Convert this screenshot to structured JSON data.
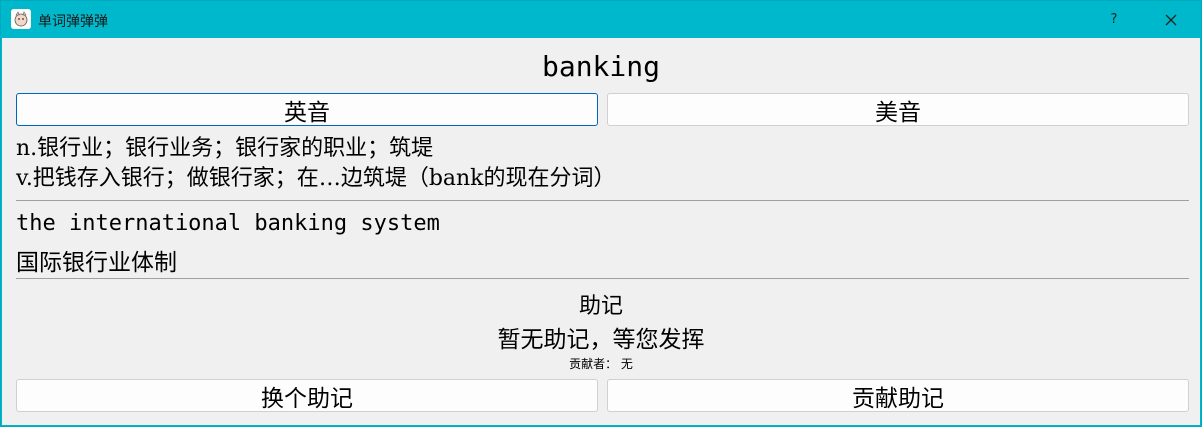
{
  "window": {
    "title": "单词弹弹弹",
    "help_label": "?",
    "close_label": "✕",
    "icon": "cartoon-app-icon"
  },
  "word": "banking",
  "pronunciation": {
    "uk_label": "英音",
    "us_label": "美音"
  },
  "definitions": [
    "n.银行业；银行业务；银行家的职业；筑堤",
    "v.把钱存入银行；做银行家；在…边筑堤（bank的现在分词）"
  ],
  "example": {
    "en": "the international banking system",
    "zh": "国际银行业体制"
  },
  "mnemonic": {
    "title": "助记",
    "text": "暂无助记，等您发挥",
    "contributor": "贡献者： 无",
    "next_label": "换个助记",
    "contribute_label": "贡献助记"
  },
  "colors": {
    "titlebar": "#00b8cb",
    "client_bg": "#f0f0f0",
    "focus_border": "#0067c0"
  }
}
